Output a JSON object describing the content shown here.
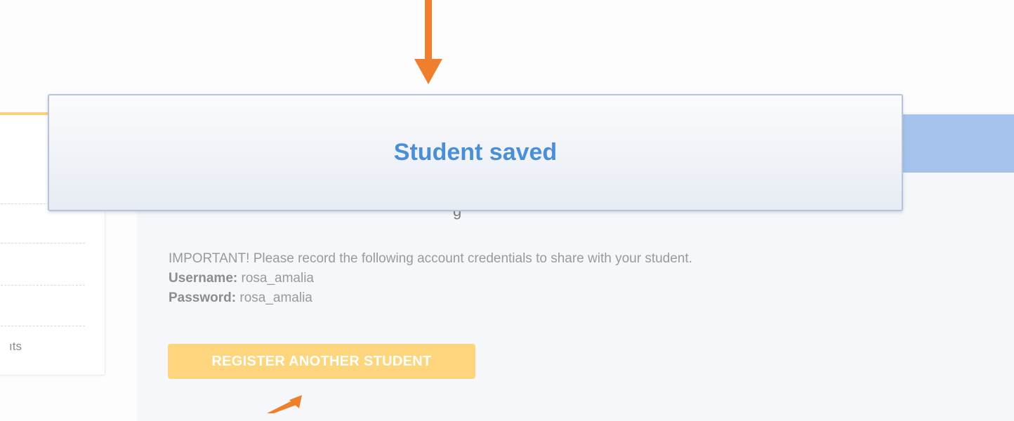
{
  "sidebar": {
    "partial_item_label": "ıts"
  },
  "main": {
    "partial_heading": "g",
    "important_text": "IMPORTANT! Please record the following account credentials to share with your student.",
    "username_label": "Username:",
    "username_value": "rosa_amalia",
    "password_label": "Password:",
    "password_value": "rosa_amalia",
    "register_button_label": "REGISTER ANOTHER STUDENT"
  },
  "toast": {
    "message": "Student saved"
  },
  "colors": {
    "accent_orange": "#ef7f2d",
    "button_yellow": "#fcd57c",
    "toast_text_blue": "#4a8fd6",
    "header_bar_blue": "#a4c2ec"
  },
  "icons": {
    "annotation_arrow_down": "arrow-down-icon",
    "annotation_arrow_up": "arrow-up-icon"
  }
}
